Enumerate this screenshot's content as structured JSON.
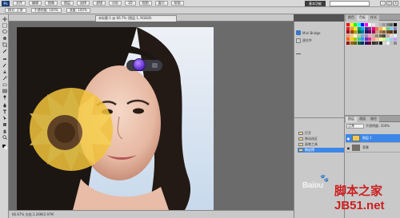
{
  "app": {
    "logo_text": "Ps",
    "menu_buttons": [
      "文件",
      "编辑",
      "图像",
      "图层",
      "选择",
      "滤镜",
      "分析",
      "3D",
      "视图",
      "窗口",
      "帮助"
    ],
    "workspace_button": "基本功能",
    "window_controls": [
      "-",
      "□",
      "×"
    ]
  },
  "options_bar": {
    "items": [
      "模式: 正常",
      "不透明度: 100%",
      "流量: 100%"
    ]
  },
  "document": {
    "tab_title": "未标题-1 @ 66.7% (图层 1, RGB/8)",
    "status_text": "66.67%  文档:1.26M/2.97M"
  },
  "tools": [
    "move",
    "marquee",
    "lasso",
    "quick-select",
    "crop",
    "eyedropper",
    "healing",
    "brush",
    "clone-stamp",
    "history-brush",
    "eraser",
    "gradient",
    "dodge",
    "pen",
    "type",
    "path-select",
    "shape",
    "hand",
    "zoom"
  ],
  "mid_dock": {
    "items": [
      {
        "label": "Mini Bridge",
        "icon": "mini-bridge-icon"
      },
      {
        "label": "源文件",
        "icon": "file-icon"
      }
    ]
  },
  "swatch_panel": {
    "tabs": [
      "颜色",
      "色板",
      "样式"
    ],
    "colors": [
      "#ff0000",
      "#ffff00",
      "#00ff00",
      "#00ffff",
      "#0000ff",
      "#ff00ff",
      "#ffffff",
      "#e6e6e6",
      "#cccccc",
      "#b3b3b3",
      "#999999",
      "#808080",
      "#666666",
      "#000000",
      "#ed1c24",
      "#f7941d",
      "#fff200",
      "#00a651",
      "#00aeef",
      "#2e3192",
      "#92278f",
      "#ec008c",
      "#f26c4f",
      "#fbaf5d",
      "#fff799",
      "#7cc576",
      "#6dcff6",
      "#8781bd",
      "#9e0b0f",
      "#a0410d",
      "#aba000",
      "#007236",
      "#0076a3",
      "#1b1464",
      "#630460",
      "#9e005d",
      "#c69c6d",
      "#a67c52",
      "#8c6239",
      "#754c24",
      "#603913",
      "#3c2415",
      "#f69679",
      "#fdc689",
      "#fffdbb",
      "#a3d39c",
      "#7da7d9",
      "#a186be",
      "#f49ac2",
      "#c7b299",
      "#998675",
      "#736357",
      "#534741",
      "#c9a7a7",
      "#ffd5c4",
      "#d7f5ff",
      "#ff6600",
      "#ffcc00",
      "#99cc00",
      "#33cc99",
      "#3399ff",
      "#6633cc",
      "#cc3399",
      "#ff9999",
      "#ffcc99",
      "#ffff99",
      "#ccff99",
      "#99ffcc",
      "#99ccff",
      "#cc99ff",
      "#990000",
      "#996600",
      "#666600",
      "#006633",
      "#003366",
      "#330066",
      "#660033",
      "#333333",
      "#4d4d4d",
      "#1a1a1a",
      "#d9d9d9",
      "#f2f2f2",
      "#bfbfbf",
      "#8c8c8c"
    ]
  },
  "history_panel": {
    "rows": [
      {
        "label": "打开",
        "selected": false
      },
      {
        "label": "移动选区",
        "selected": false
      },
      {
        "label": "画笔工具",
        "selected": false
      },
      {
        "label": "橡皮擦",
        "selected": true
      }
    ]
  },
  "layers_panel": {
    "tabs": [
      "图层",
      "通道",
      "路径"
    ],
    "blend_mode": "正常",
    "opacity_label": "不透明度: 100%",
    "layers": [
      {
        "name": "图层 1",
        "type": "flower",
        "selected": true
      },
      {
        "name": "背景",
        "type": "bg",
        "selected": false
      }
    ]
  },
  "watermarks": {
    "baidu": "Baiᴅu",
    "site": "脚本之家",
    "url": "JB51.net"
  }
}
